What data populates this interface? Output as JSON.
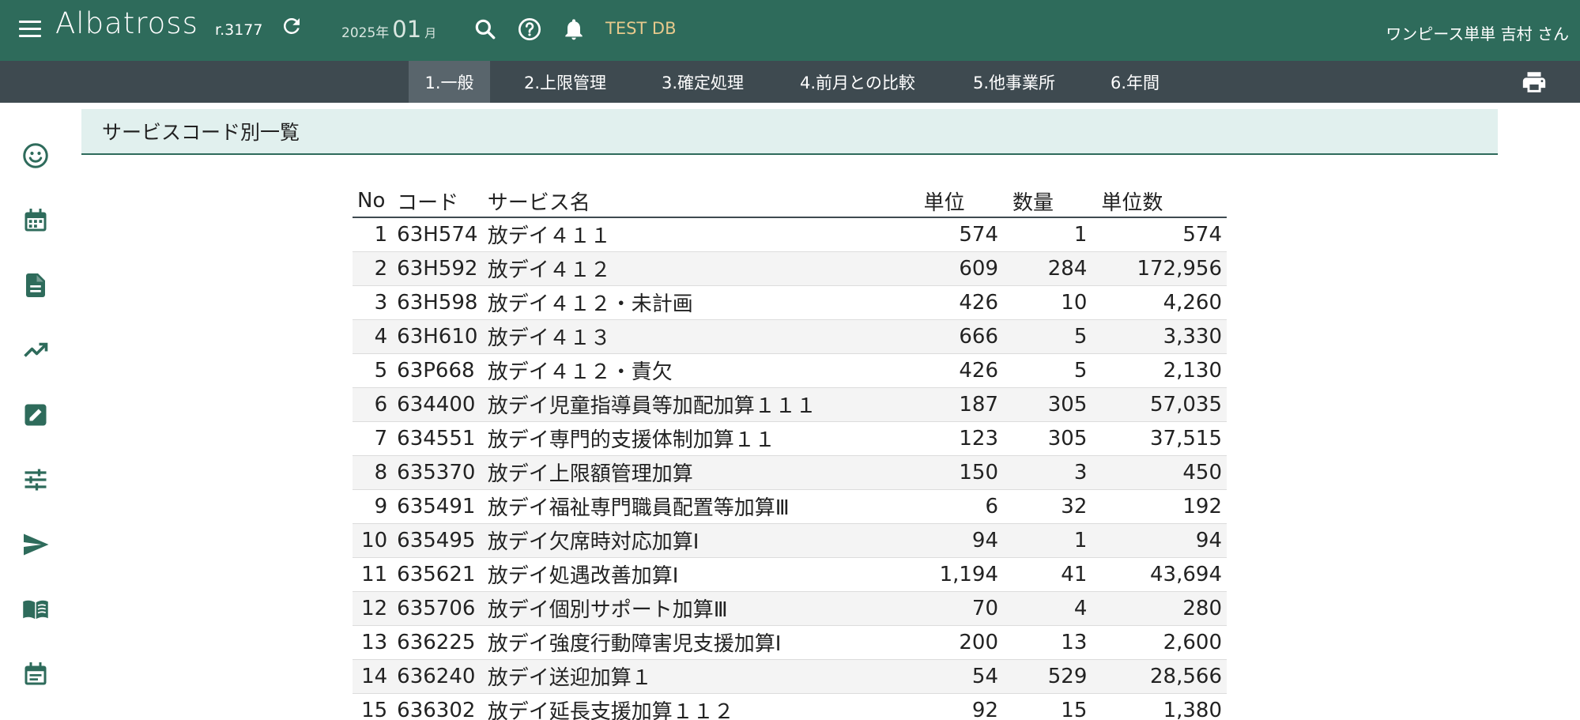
{
  "header": {
    "logo": "Albatross",
    "revision": "r.3177",
    "year": "2025年",
    "month": "01",
    "month_suffix": "月",
    "db_label": "TEST DB",
    "user": "ワンピース単単 吉村 さん",
    "colors": {
      "header_bg": "#2e6b5b",
      "db_label": "#e7c98c"
    }
  },
  "tabs": [
    {
      "label": "1.一般",
      "active": true
    },
    {
      "label": "2.上限管理",
      "active": false
    },
    {
      "label": "3.確定処理",
      "active": false
    },
    {
      "label": "4.前月との比較",
      "active": false
    },
    {
      "label": "5.他事業所",
      "active": false
    },
    {
      "label": "6.年間",
      "active": false
    }
  ],
  "rail_icons": [
    "smiley-icon",
    "calendar-icon",
    "document-icon",
    "trending-up-icon",
    "edit-icon",
    "sliders-icon",
    "send-icon",
    "book-icon",
    "event-note-icon"
  ],
  "panel": {
    "title": "サービスコード別一覧"
  },
  "table": {
    "headers": {
      "no": "No",
      "code": "コード",
      "name": "サービス名",
      "unit": "単位",
      "qty": "数量",
      "total": "単位数"
    },
    "rows": [
      {
        "no": "1",
        "code": "63H574",
        "name": "放デイ４１１",
        "unit": "574",
        "qty": "1",
        "total": "574"
      },
      {
        "no": "2",
        "code": "63H592",
        "name": "放デイ４１２",
        "unit": "609",
        "qty": "284",
        "total": "172,956"
      },
      {
        "no": "3",
        "code": "63H598",
        "name": "放デイ４１２・未計画",
        "unit": "426",
        "qty": "10",
        "total": "4,260"
      },
      {
        "no": "4",
        "code": "63H610",
        "name": "放デイ４１３",
        "unit": "666",
        "qty": "5",
        "total": "3,330"
      },
      {
        "no": "5",
        "code": "63P668",
        "name": "放デイ４１２・責欠",
        "unit": "426",
        "qty": "5",
        "total": "2,130"
      },
      {
        "no": "6",
        "code": "634400",
        "name": "放デイ児童指導員等加配加算１１１",
        "unit": "187",
        "qty": "305",
        "total": "57,035"
      },
      {
        "no": "7",
        "code": "634551",
        "name": "放デイ専門的支援体制加算１１",
        "unit": "123",
        "qty": "305",
        "total": "37,515"
      },
      {
        "no": "8",
        "code": "635370",
        "name": "放デイ上限額管理加算",
        "unit": "150",
        "qty": "3",
        "total": "450"
      },
      {
        "no": "9",
        "code": "635491",
        "name": "放デイ福祉専門職員配置等加算Ⅲ",
        "unit": "6",
        "qty": "32",
        "total": "192"
      },
      {
        "no": "10",
        "code": "635495",
        "name": "放デイ欠席時対応加算Ⅰ",
        "unit": "94",
        "qty": "1",
        "total": "94"
      },
      {
        "no": "11",
        "code": "635621",
        "name": "放デイ処遇改善加算Ⅰ",
        "unit": "1,194",
        "qty": "41",
        "total": "43,694"
      },
      {
        "no": "12",
        "code": "635706",
        "name": "放デイ個別サポート加算Ⅲ",
        "unit": "70",
        "qty": "4",
        "total": "280"
      },
      {
        "no": "13",
        "code": "636225",
        "name": "放デイ強度行動障害児支援加算Ⅰ",
        "unit": "200",
        "qty": "13",
        "total": "2,600"
      },
      {
        "no": "14",
        "code": "636240",
        "name": "放デイ送迎加算１",
        "unit": "54",
        "qty": "529",
        "total": "28,566"
      },
      {
        "no": "15",
        "code": "636302",
        "name": "放デイ延長支援加算１１２",
        "unit": "92",
        "qty": "15",
        "total": "1,380"
      }
    ]
  }
}
